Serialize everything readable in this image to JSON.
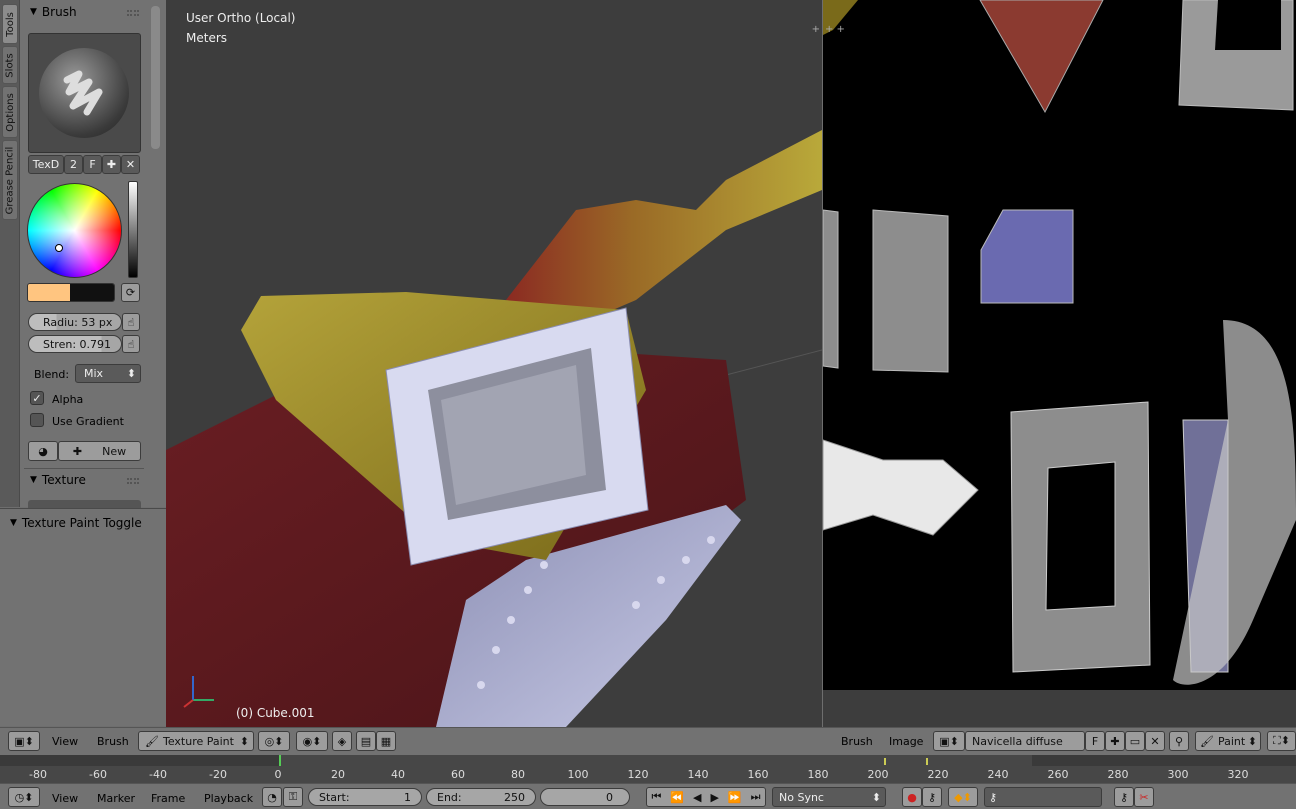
{
  "left_tabs": [
    "Tools",
    "Slots",
    "Options",
    "Grease Pencil"
  ],
  "brush_panel": {
    "title": "Brush",
    "brush_name": "TexD",
    "users": "2",
    "fake_user": "F",
    "radius": "Radiu: 53 px",
    "strength": "Stren: 0.791",
    "blend_label": "Blend:",
    "blend_value": "Mix",
    "alpha_label": "Alpha",
    "use_gradient_label": "Use Gradient",
    "new_label": "New",
    "primary_color": "#ffc580",
    "secondary_color": "#111111"
  },
  "texture_panel": {
    "title": "Texture"
  },
  "toggle_panel": {
    "title": "Texture Paint Toggle"
  },
  "viewport": {
    "view_name": "User Ortho (Local)",
    "units": "Meters",
    "object_label": "(0) Cube.001"
  },
  "view3d_header": {
    "menus": [
      "View",
      "Brush"
    ],
    "mode": "Texture Paint"
  },
  "uv_header": {
    "menus": [
      "Brush",
      "Image"
    ],
    "image_name": "Navicella diffuse",
    "fake_user": "F",
    "mode": "Paint"
  },
  "timeline": {
    "ticks": [
      "-80",
      "-60",
      "-40",
      "-20",
      "0",
      "20",
      "40",
      "60",
      "80",
      "100",
      "120",
      "140",
      "160",
      "180",
      "200",
      "220",
      "240",
      "260",
      "280",
      "300",
      "320"
    ],
    "current_frame_pct": 0
  },
  "timeline_header": {
    "menus": [
      "View",
      "Marker",
      "Frame",
      "Playback"
    ],
    "start_label": "Start:",
    "start_value": "1",
    "end_label": "End:",
    "end_value": "250",
    "current": "0",
    "sync": "No Sync"
  }
}
